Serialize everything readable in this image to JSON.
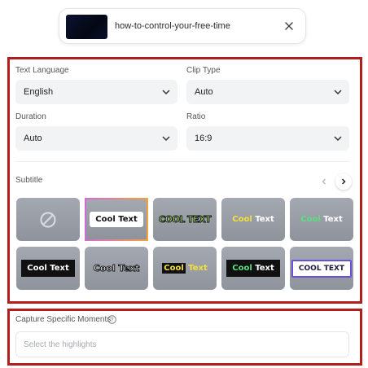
{
  "file": {
    "name": "how-to-control-your-free-time"
  },
  "settings": {
    "text_language": {
      "label": "Text Language",
      "value": "English"
    },
    "clip_type": {
      "label": "Clip Type",
      "value": "Auto"
    },
    "duration": {
      "label": "Duration",
      "value": "Auto"
    },
    "ratio": {
      "label": "Ratio",
      "value": "16:9"
    }
  },
  "subtitle": {
    "label": "Subtitle",
    "selected_index": 1,
    "styles": [
      {
        "name": "none",
        "text": ""
      },
      {
        "name": "white-box",
        "text": "Cool Text"
      },
      {
        "name": "green-outline",
        "text": "COOL TEXT"
      },
      {
        "name": "yellow-white",
        "a": "Cool",
        "b": " Text"
      },
      {
        "name": "green-white",
        "a": "Cool",
        "b": " Text"
      },
      {
        "name": "black-box",
        "text": "Cool Text"
      },
      {
        "name": "white-outline",
        "text": "Cool Text"
      },
      {
        "name": "yellow-black",
        "a": "Cool",
        "b": " Text"
      },
      {
        "name": "black-box-green",
        "a": "Cool",
        "b": " Text"
      },
      {
        "name": "purple-box",
        "text": "COOL TEXT"
      }
    ]
  },
  "capture": {
    "label": "Capture Specific Moments",
    "placeholder": "Select the highlights"
  },
  "colors": {
    "annotation_red": "#b01e1e",
    "selected_gradient": [
      "#d36ad6",
      "#f2a33b"
    ]
  }
}
